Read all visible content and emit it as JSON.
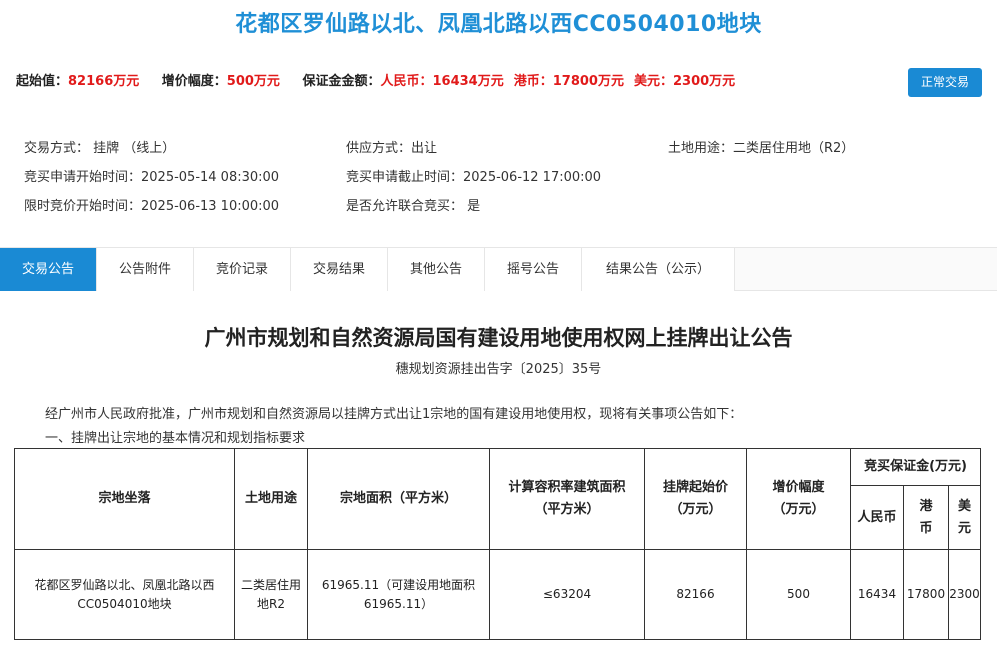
{
  "title": "花都区罗仙路以北、凤凰北路以西CC0504010地块",
  "price": {
    "start_label": "起始值：",
    "start_value": "82166万元",
    "step_label": "增价幅度：",
    "step_value": "500万元",
    "deposit_label": "保证金金额：",
    "rmb_label": "人民币：",
    "rmb_value": "16434万元",
    "hkd_label": "港币：",
    "hkd_value": "17800万元",
    "usd_label": "美元：",
    "usd_value": "2300万元"
  },
  "status_button": "正常交易",
  "info": {
    "trade_method": "交易方式： 挂牌 （线上）",
    "supply_method": "供应方式：出让",
    "land_use": "土地用途：二类居住用地（R2）",
    "apply_start": "竞买申请开始时间：2025-05-14 08:30:00",
    "apply_end": "竞买申请截止时间：2025-06-12 17:00:00",
    "bid_start": "限时竞价开始时间：2025-06-13 10:00:00",
    "joint_bid": "是否允许联合竞买： 是"
  },
  "tabs": [
    "交易公告",
    "公告附件",
    "竞价记录",
    "交易结果",
    "其他公告",
    "摇号公告",
    "结果公告（公示）"
  ],
  "notice": {
    "title": "广州市规划和自然资源局国有建设用地使用权网上挂牌出让公告",
    "doc_no": "穗规划资源挂出告字〔2025〕35号",
    "intro": "经广州市人民政府批准，广州市规划和自然资源局以挂牌方式出让1宗地的国有建设用地使用权，现将有关事项公告如下：",
    "section1": "一、挂牌出让宗地的基本情况和规划指标要求"
  },
  "table": {
    "headers": {
      "location": "宗地坐落",
      "use": "土地用途",
      "area": "宗地面积（平方米）",
      "far_area": "计算容积率建筑面积（平方米）",
      "start_price": "挂牌起始价（万元）",
      "step": "增价幅度（万元）",
      "deposit": "竞买保证金(万元)",
      "rmb": "人民币",
      "hkd": "港币",
      "usd": "美元"
    },
    "row": {
      "location": "花都区罗仙路以北、凤凰北路以西CC0504010地块",
      "use": "二类居住用地R2",
      "area": "61965.11（可建设用地面积61965.11）",
      "far_area": "≤63204",
      "start_price": "82166",
      "step": "500",
      "rmb": "16434",
      "hkd": "17800",
      "usd": "2300"
    }
  }
}
